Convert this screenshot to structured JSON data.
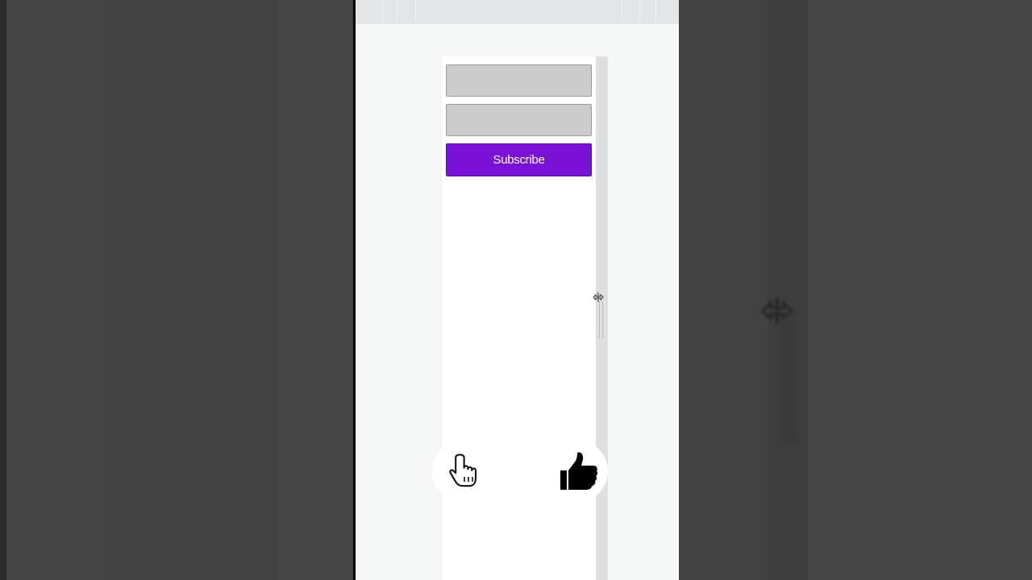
{
  "form": {
    "name_value": "",
    "email_value": "",
    "subscribe_label": "Subscribe"
  },
  "cursors": {
    "resize_glyph": "⟺"
  },
  "icons": {
    "pointer": "hand-pointer-icon",
    "like": "thumbs-up-icon",
    "resize": "horizontal-resize-icon"
  },
  "colors": {
    "subscribe_button": "#7a12d6",
    "input_fill": "#cccccc",
    "panel_background": "#f6f8f8",
    "toolbar": "#e3e6e8"
  }
}
